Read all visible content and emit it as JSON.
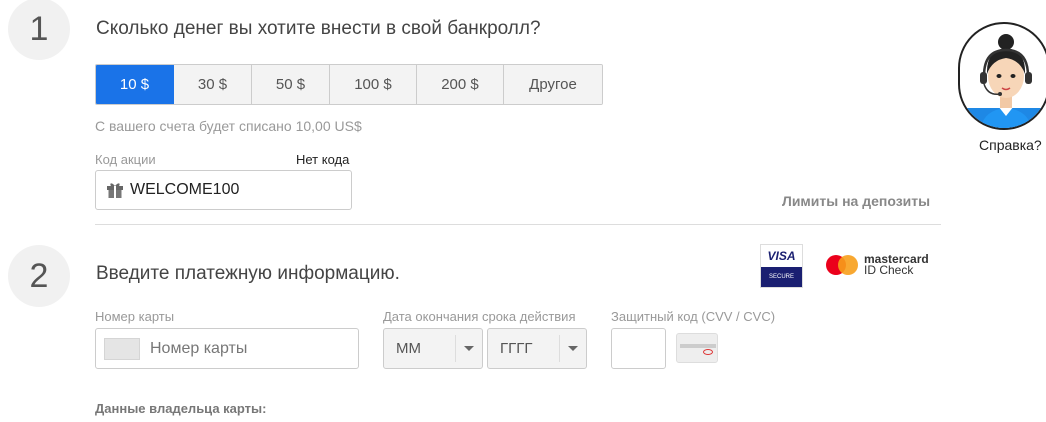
{
  "step1": {
    "number": "1",
    "title": "Сколько денег вы хотите внести в свой банкролл?",
    "amounts": [
      {
        "label": "10 $",
        "active": true
      },
      {
        "label": "30 $",
        "active": false
      },
      {
        "label": "50 $",
        "active": false
      },
      {
        "label": "100 $",
        "active": false
      },
      {
        "label": "200 $",
        "active": false
      },
      {
        "label": "Другое",
        "active": false
      }
    ],
    "debit_note": "С вашего счета будет списано 10,00 US$",
    "promo_label": "Код акции",
    "no_code_link": "Нет кода",
    "promo_value": "WELCOME100",
    "limits_link": "Лимиты на депозиты"
  },
  "step2": {
    "number": "2",
    "title": "Введите платежную информацию.",
    "visa_text": "VISA",
    "visa_secure": "SECURE",
    "mastercard_text": "mastercard",
    "mastercard_sub": "ID Check",
    "card_label": "Номер карты",
    "card_placeholder": "Номер карты",
    "expiry_label": "Дата окончания срока действия",
    "month_value": "ММ",
    "year_value": "ГГГГ",
    "cvv_label": "Защитный код (CVV / CVC)",
    "holder_label": "Данные владельца карты:"
  },
  "help": {
    "label": "Справка?",
    "icon": "support-agent-icon"
  },
  "colors": {
    "accent": "#1a73e8",
    "visa_blue": "#1a1f71",
    "mc_red": "#eb001b",
    "mc_orange": "#f79e1b"
  }
}
